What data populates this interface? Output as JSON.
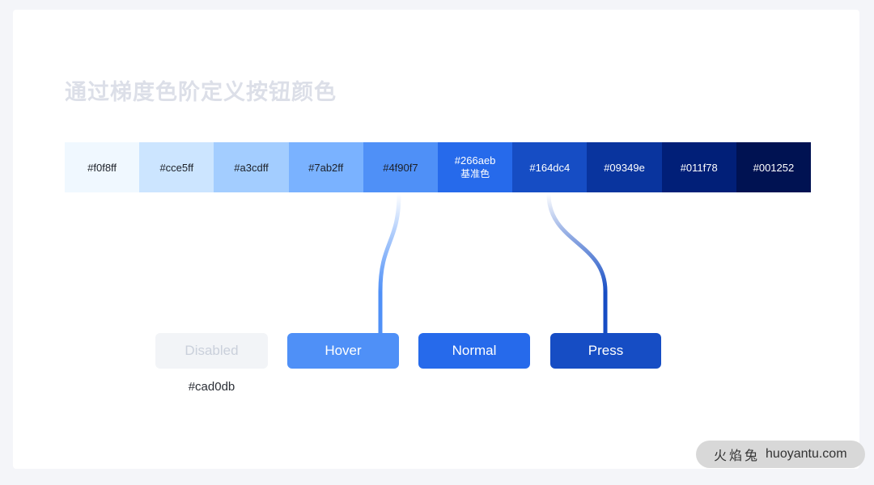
{
  "page": {
    "background_color": "#f4f5f9",
    "card_color": "#ffffff"
  },
  "title": "通过梯度色阶定义按钮颜色",
  "palette": {
    "swatches": [
      {
        "hex": "#f0f8ff",
        "note": "",
        "text_mode": "dark"
      },
      {
        "hex": "#cce5ff",
        "note": "",
        "text_mode": "dark"
      },
      {
        "hex": "#a3cdff",
        "note": "",
        "text_mode": "dark"
      },
      {
        "hex": "#7ab2ff",
        "note": "",
        "text_mode": "dark"
      },
      {
        "hex": "#4f90f7",
        "note": "",
        "text_mode": "dark"
      },
      {
        "hex": "#266aeb",
        "note": "基准色",
        "text_mode": "light"
      },
      {
        "hex": "#164dc4",
        "note": "",
        "text_mode": "light"
      },
      {
        "hex": "#09349e",
        "note": "",
        "text_mode": "light"
      },
      {
        "hex": "#011f78",
        "note": "",
        "text_mode": "light"
      },
      {
        "hex": "#001252",
        "note": "",
        "text_mode": "light"
      }
    ]
  },
  "buttons": {
    "disabled": {
      "label": "Disabled",
      "background": "#f2f4f7",
      "text_color": "#cad0db"
    },
    "hover": {
      "label": "Hover",
      "background": "#4f90f7",
      "text_color": "#ffffff"
    },
    "normal": {
      "label": "Normal",
      "background": "#266aeb",
      "text_color": "#ffffff"
    },
    "press": {
      "label": "Press",
      "background": "#164dc4",
      "text_color": "#ffffff"
    }
  },
  "caption": {
    "disabled_hex": "#cad0db"
  },
  "connectors": [
    {
      "from_swatch": "#4f90f7",
      "to_button": "Hover"
    },
    {
      "from_swatch": "#266aeb",
      "to_button": "Normal"
    },
    {
      "from_swatch": "#164dc4",
      "to_button": "Press"
    }
  ],
  "watermark": {
    "brand_cn": "火焰兔",
    "domain": "huoyantu.com"
  }
}
